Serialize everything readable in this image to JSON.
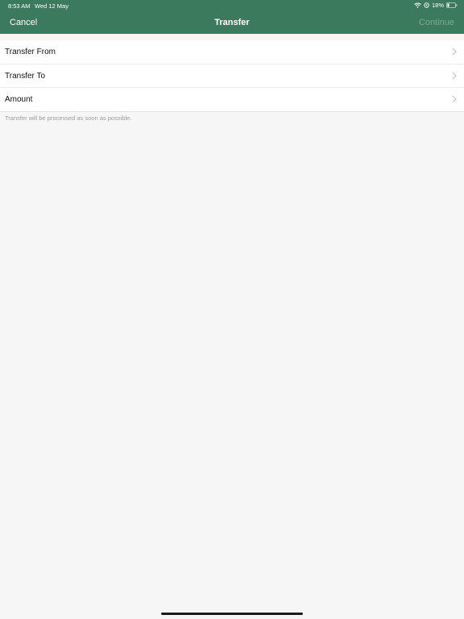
{
  "status_bar": {
    "time": "8:53 AM",
    "date": "Wed 12 May",
    "battery": "18%",
    "icons": [
      "wifi-icon",
      "location-icon",
      "battery-icon"
    ]
  },
  "nav": {
    "cancel_label": "Cancel",
    "title": "Transfer",
    "continue_label": "Continue"
  },
  "form": {
    "rows": [
      {
        "label": "Transfer From"
      },
      {
        "label": "Transfer To"
      },
      {
        "label": "Amount"
      }
    ],
    "footnote": "Transfer will be processed as soon as possible."
  },
  "colors": {
    "header": "#3c7a5e",
    "disabled_action": "#7eaa93",
    "background": "#f6f6f6"
  }
}
